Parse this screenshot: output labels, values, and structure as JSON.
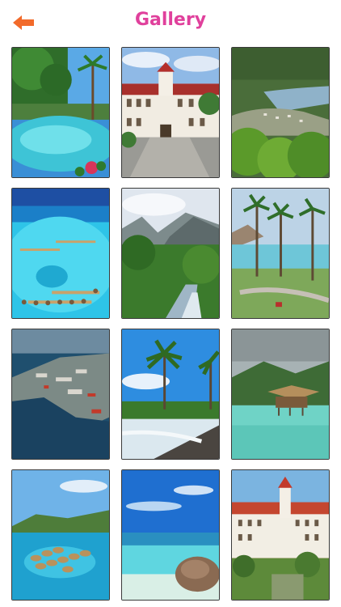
{
  "header": {
    "title": "Gallery",
    "back_icon": "back-arrow-icon",
    "back_color": "#f26a2a"
  },
  "accent": "#e0409c",
  "gallery": {
    "photos": [
      {
        "subject": "pool-with-palms"
      },
      {
        "subject": "colonial-mansion"
      },
      {
        "subject": "aerial-coast-valley"
      },
      {
        "subject": "overwater-bungalows-lagoon"
      },
      {
        "subject": "mountain-valley-river"
      },
      {
        "subject": "resort-palms-beach"
      },
      {
        "subject": "harbor-aerial"
      },
      {
        "subject": "black-sand-beach-palms"
      },
      {
        "subject": "overwater-hut-mountains"
      },
      {
        "subject": "island-bungalows-aerial"
      },
      {
        "subject": "turquoise-beach-rock"
      },
      {
        "subject": "white-hotel-red-roof"
      }
    ]
  }
}
